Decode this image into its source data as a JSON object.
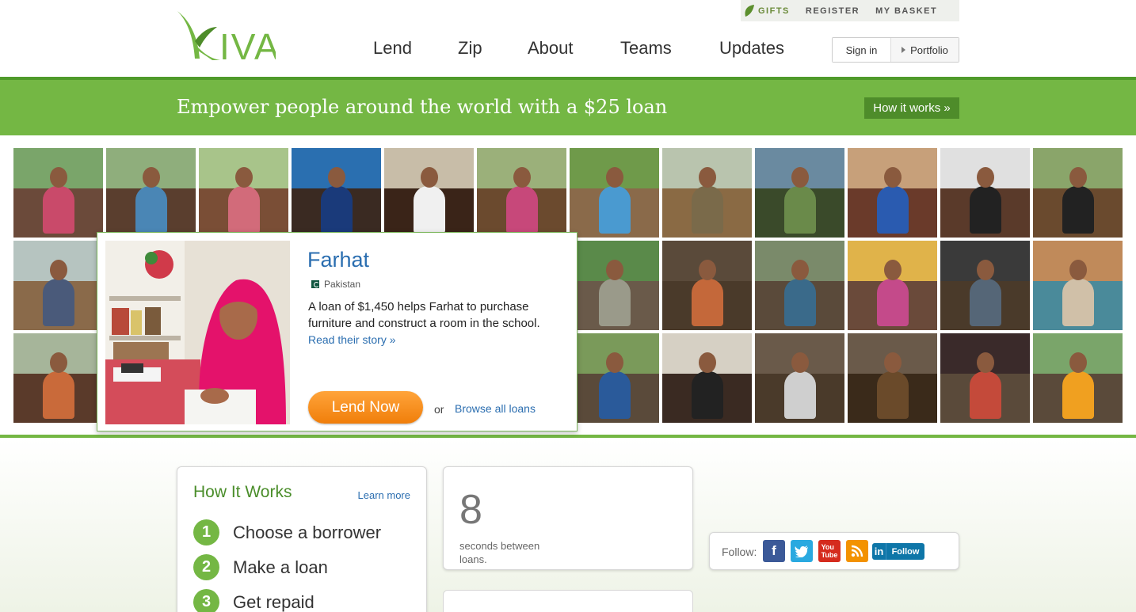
{
  "header": {
    "logo_text": "KIVA",
    "util": {
      "gifts": "GIFTS",
      "register": "REGISTER",
      "basket": "MY BASKET"
    },
    "nav": [
      "Lend",
      "Zip",
      "About",
      "Teams",
      "Updates"
    ],
    "sign_in": "Sign in",
    "portfolio": "Portfolio"
  },
  "banner": {
    "text": "Empower people around the world with a $25 loan",
    "button": "How it works »"
  },
  "feature": {
    "name": "Farhat",
    "country": "Pakistan",
    "description": "A loan of $1,450 helps Farhat to purchase furniture and construct a room in the school.",
    "read_story": "Read their story »",
    "lend_now": "Lend Now",
    "or": "or",
    "browse": "Browse all loans"
  },
  "how_it_works": {
    "title": "How It Works",
    "learn_more": "Learn more",
    "steps": [
      {
        "num": "1",
        "label": "Choose a borrower"
      },
      {
        "num": "2",
        "label": "Make a loan"
      },
      {
        "num": "3",
        "label": "Get repaid"
      }
    ]
  },
  "stat": {
    "number": "8",
    "label": "seconds between loans."
  },
  "follow": {
    "label": "Follow:",
    "linkedin": "Follow",
    "icons": [
      "facebook-icon",
      "twitter-icon",
      "youtube-icon",
      "rss-icon",
      "linkedin-icon"
    ]
  },
  "colors": {
    "brand_green": "#74b744",
    "dark_green": "#4e8c2a",
    "link_blue": "#2b6eb0",
    "lend_orange": "#f58a1f"
  }
}
